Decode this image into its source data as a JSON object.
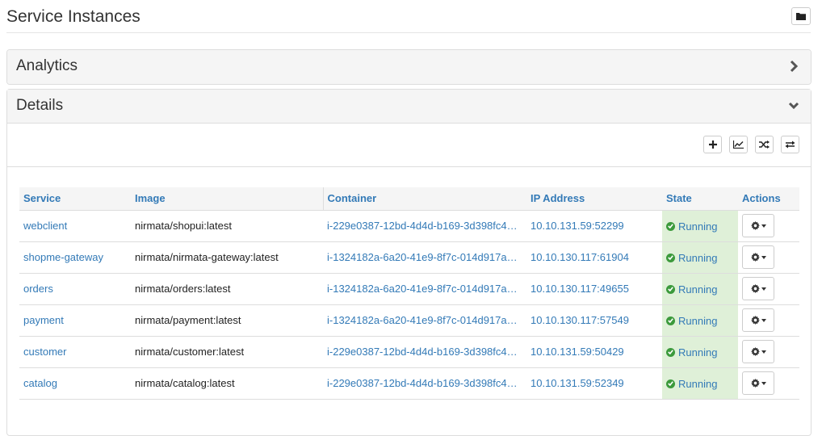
{
  "page": {
    "title": "Service Instances"
  },
  "panels": {
    "analytics": {
      "title": "Analytics"
    },
    "details": {
      "title": "Details"
    }
  },
  "table": {
    "headers": {
      "service": "Service",
      "image": "Image",
      "container": "Container",
      "ip": "IP Address",
      "state": "State",
      "actions": "Actions"
    },
    "rows": [
      {
        "service": "webclient",
        "image": "nirmata/shopui:latest",
        "container": "i-229e0387-12bd-4d4d-b169-3d398fc4d…",
        "ip": "10.10.131.59:52299",
        "state": "Running"
      },
      {
        "service": "shopme-gateway",
        "image": "nirmata/nirmata-gateway:latest",
        "container": "i-1324182a-6a20-41e9-8f7c-014d917a0…",
        "ip": "10.10.130.117:61904",
        "state": "Running"
      },
      {
        "service": "orders",
        "image": "nirmata/orders:latest",
        "container": "i-1324182a-6a20-41e9-8f7c-014d917a0…",
        "ip": "10.10.130.117:49655",
        "state": "Running"
      },
      {
        "service": "payment",
        "image": "nirmata/payment:latest",
        "container": "i-1324182a-6a20-41e9-8f7c-014d917a0…",
        "ip": "10.10.130.117:57549",
        "state": "Running"
      },
      {
        "service": "customer",
        "image": "nirmata/customer:latest",
        "container": "i-229e0387-12bd-4d4d-b169-3d398fc4d…",
        "ip": "10.10.131.59:50429",
        "state": "Running"
      },
      {
        "service": "catalog",
        "image": "nirmata/catalog:latest",
        "container": "i-229e0387-12bd-4d4d-b169-3d398fc4d…",
        "ip": "10.10.131.59:52349",
        "state": "Running"
      }
    ]
  },
  "colors": {
    "link": "#337ab7",
    "running_bg": "#dff0d8",
    "running_icon": "#3c9a3c",
    "panel_heading_bg": "#f5f5f5"
  },
  "icons": {
    "header": "folder-icon",
    "analytics_toggle": "chevron-right-icon",
    "details_toggle": "chevron-down-icon",
    "toolbar": [
      "plus-icon",
      "line-chart-icon",
      "shuffle-icon",
      "swap-icon"
    ],
    "state": "check-circle-icon",
    "action": "gear-icon"
  }
}
